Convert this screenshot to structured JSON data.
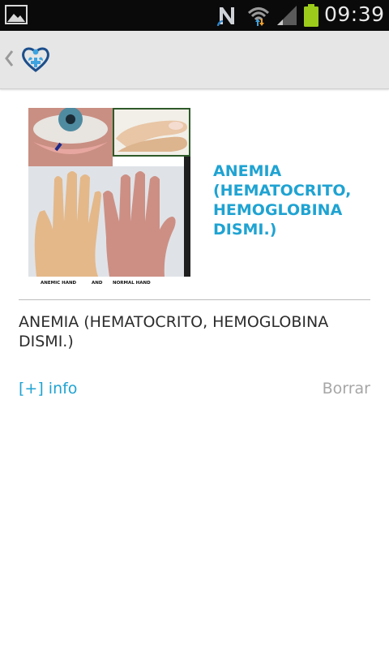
{
  "status_bar": {
    "time": "09:39",
    "icons": [
      "gallery-icon",
      "n-notification-icon",
      "wifi-icon",
      "signal-icon",
      "battery-icon"
    ]
  },
  "action_bar": {
    "icons": [
      "back-chevron-icon",
      "app-logo-icon"
    ]
  },
  "item": {
    "image_labels": {
      "left": "ANEMIC HAND",
      "middle": "AND",
      "right": "NORMAL HAND"
    },
    "title": "ANEMIA (HEMATOCRITO, HEMOGLOBINA DISMI.)",
    "description": "ANEMIA (HEMATOCRITO, HEMOGLOBINA DISMI.)",
    "info_label": "[+] info",
    "delete_label": "Borrar"
  },
  "colors": {
    "accent": "#1fa3d2",
    "muted": "#a6a6a6",
    "battery": "#9ccb1c"
  }
}
